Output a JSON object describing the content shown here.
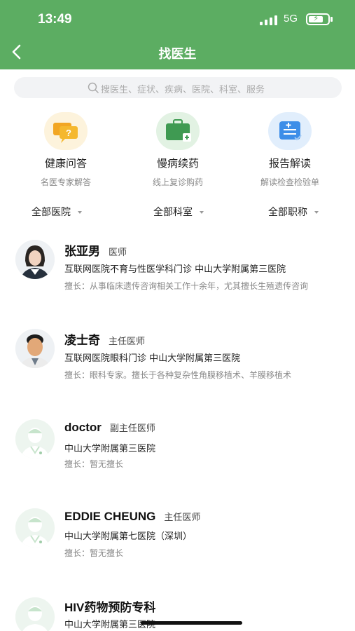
{
  "status_bar": {
    "time": "13:49",
    "network": "5G"
  },
  "header": {
    "title": "找医生"
  },
  "search": {
    "placeholder": "搜医生、症状、疾病、医院、科室、服务"
  },
  "features": [
    {
      "name": "健康问答",
      "sub": "名医专家解答",
      "icon": "chat-question-icon",
      "color": "#f5b82e"
    },
    {
      "name": "慢病续药",
      "sub": "线上复诊购药",
      "icon": "medicine-kit-icon",
      "color": "#3f9a52"
    },
    {
      "name": "报告解读",
      "sub": "解读检查检验单",
      "icon": "report-icon",
      "color": "#3d8ee8"
    }
  ],
  "filters": [
    "全部医院",
    "全部科室",
    "全部职称"
  ],
  "doctors": [
    {
      "name": "张亚男",
      "title": "医师",
      "hospital": "互联网医院不育与性医学科门诊 中山大学附属第三医院",
      "skill": "擅长：从事临床遗传咨询相关工作十余年，尤其擅长生殖遗传咨询",
      "avatar": "photo-female"
    },
    {
      "name": "凌士奇",
      "title": "主任医师",
      "hospital": "互联网医院眼科门诊 中山大学附属第三医院",
      "skill": "擅长：眼科专家。擅长于各种复杂性角膜移植术、羊膜移植术",
      "avatar": "photo-male"
    },
    {
      "name": "doctor",
      "title": "副主任医师",
      "hospital": "中山大学附属第三医院",
      "skill": "擅长：暂无擅长",
      "avatar": "default"
    },
    {
      "name": "EDDIE CHEUNG",
      "title": "主任医师",
      "hospital": "中山大学附属第七医院（深圳）",
      "skill": "擅长：暂无擅长",
      "avatar": "default"
    },
    {
      "name": "HIV药物预防专科",
      "title": "",
      "hospital": "中山大学附属第三医院",
      "skill": "",
      "avatar": "default"
    }
  ],
  "colors": {
    "brand": "#5cad62"
  }
}
